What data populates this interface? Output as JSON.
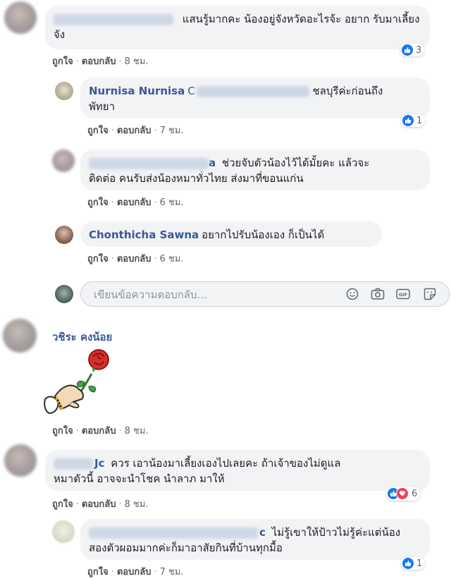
{
  "comments": [
    {
      "text": "แสนรู้มากคะ น้องอยู่จังหวัดอะไรจ้ะ อยาก รับมาเลี้ยงจัง",
      "like": "ถูกใจ",
      "reply": "ตอบกลับ",
      "time": "8 ชม.",
      "reaction_count": "3"
    },
    {
      "name": "Nurnisa Nurnisa",
      "name_suffix": "C",
      "text_line1": "ชลบุรีค่ะก่อนถึง",
      "text_line2": "พัทยา",
      "like": "ถูกใจ",
      "reply": "ตอบกลับ",
      "time": "7 ชม.",
      "reaction_count": "1"
    },
    {
      "name_tail": "a",
      "text_line1": "ช่วยจับตัวน้องไว้ได้มั้ยคะ แล้วจะ",
      "text_line2": "ติดต่อ คนรับส่งน้องหมาทั่วไทย ส่งมาที่ขอนแก่น",
      "like": "ถูกใจ",
      "reply": "ตอบกลับ",
      "time": "6 ชม."
    },
    {
      "name": "Chonthicha Sawna",
      "text": "อยากไปรับน้องเอง ก็เป็นได้",
      "like": "ถูกใจ",
      "reply": "ตอบกลับ",
      "time": "6 ชม."
    },
    {
      "name": "วชิระ คงน้อย",
      "like": "ถูกใจ",
      "reply": "ตอบกลับ",
      "time": "8 ชม."
    },
    {
      "name_tail": "Jc",
      "text_line1": "ควร เอาน้องมาเลี้ยงเองไปเลยคะ ถ้าเจ้าของไม่ดูแล",
      "text_line2": "หมาตัวนี้ อาจจะนำโชค นำลาภ มาให้",
      "like": "ถูกใจ",
      "reply": "ตอบกลับ",
      "time": "8 ชม.",
      "reaction_count": "6"
    },
    {
      "name_tail": "c",
      "text_line1": "ไม่รู้เขาให้ป้าวไม่รู้ค่ะแต่น้อง",
      "text_line2": "สองตัวผอมมากค่ะก็มาอาสัยกินที่บ้านทุกมื้อ",
      "like": "ถูกใจ",
      "reply": "ตอบกลับ",
      "time": "7 ชม.",
      "reaction_count": "1"
    }
  ],
  "reply_box": {
    "placeholder": "เขียนข้อความตอบกลับ..."
  },
  "separator": "·"
}
